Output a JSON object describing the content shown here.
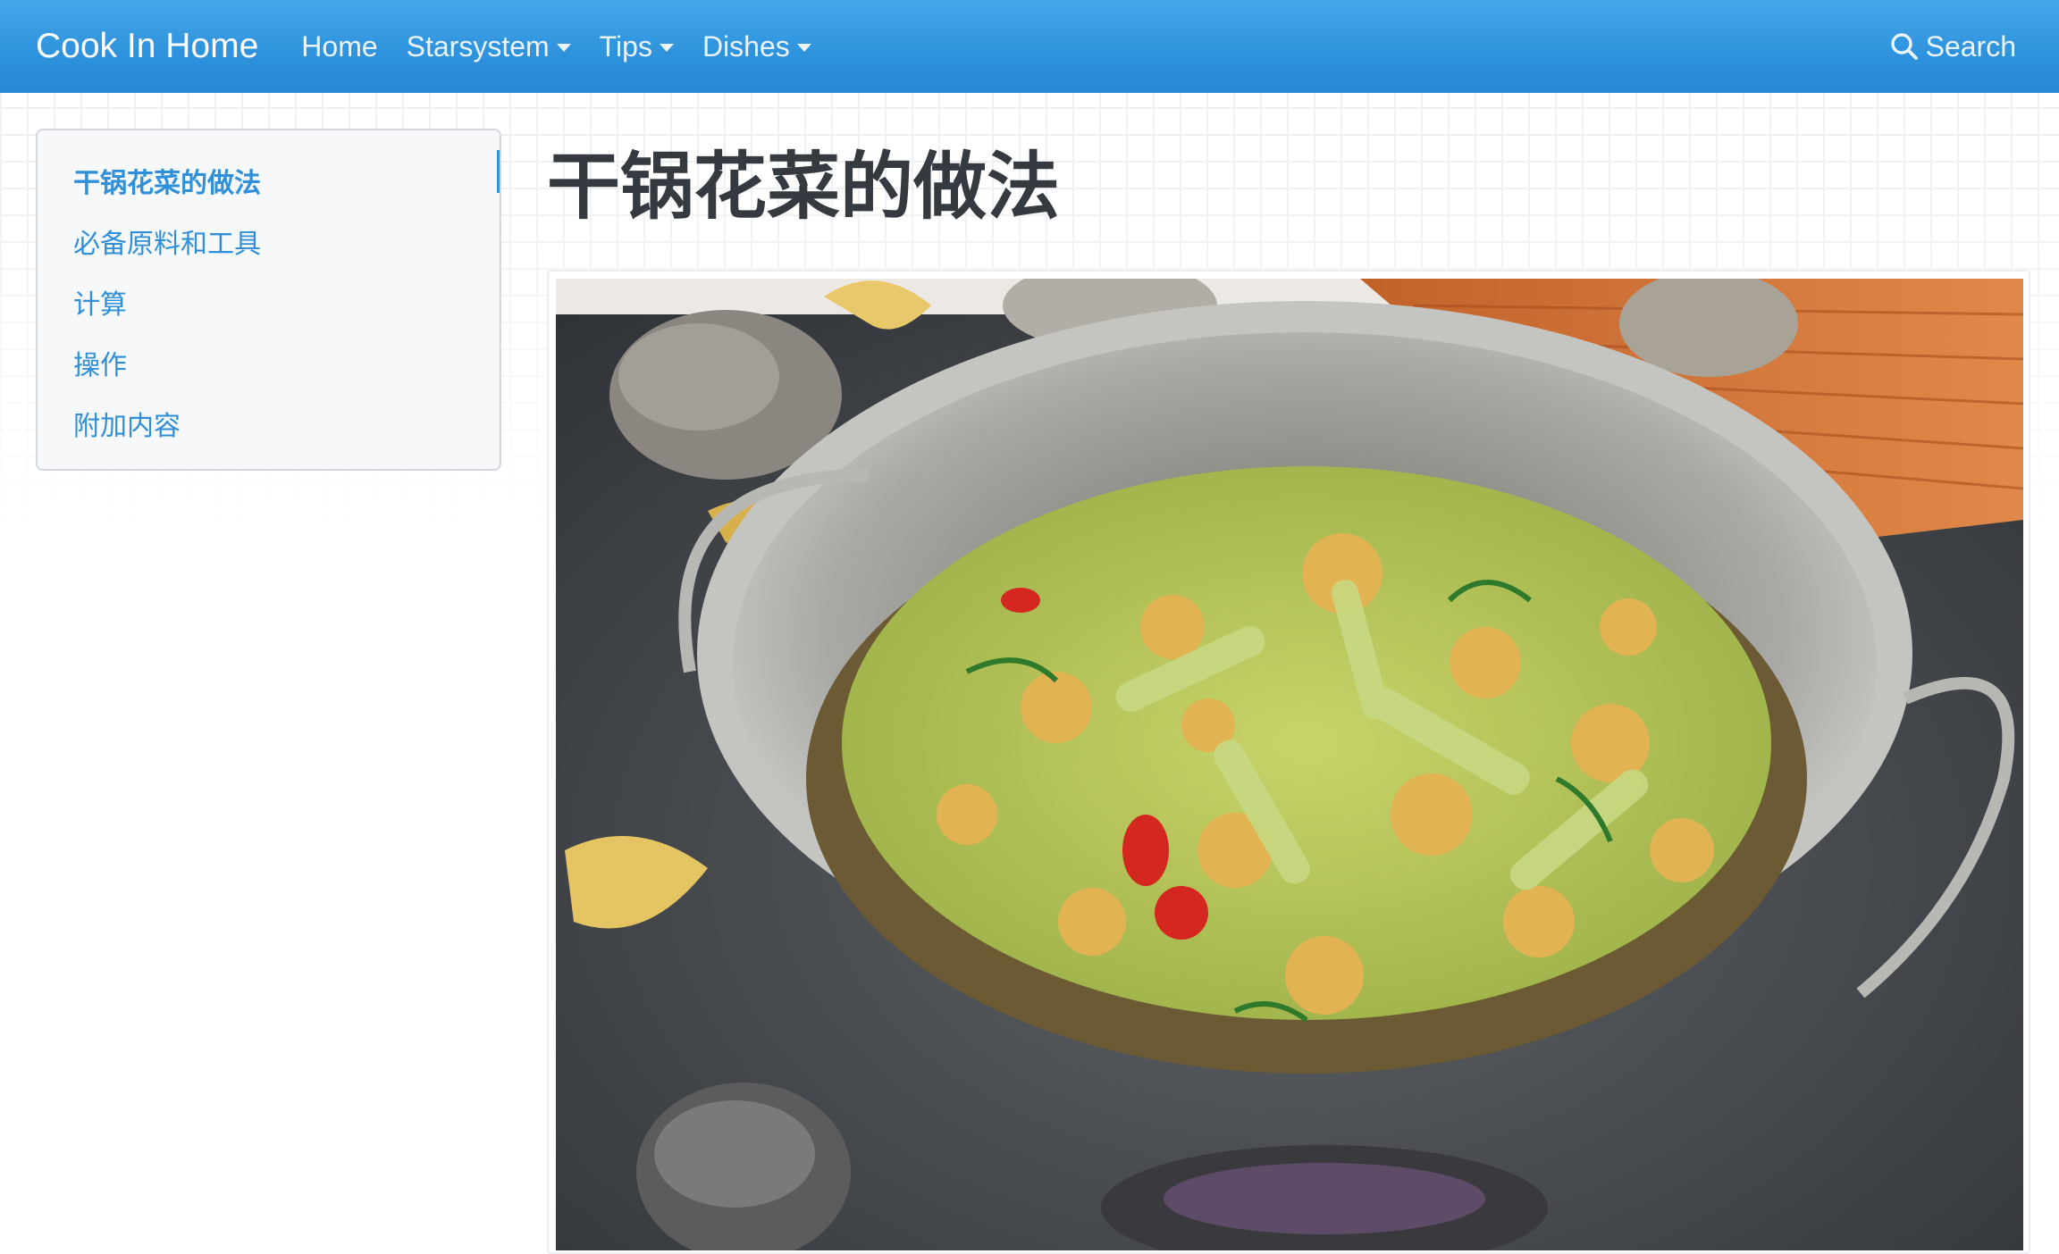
{
  "navbar": {
    "brand": "Cook In Home",
    "links": [
      {
        "label": "Home",
        "dropdown": false
      },
      {
        "label": "Starsystem",
        "dropdown": true
      },
      {
        "label": "Tips",
        "dropdown": true
      },
      {
        "label": "Dishes",
        "dropdown": true
      }
    ],
    "search_label": "Search",
    "search_icon": "search-icon"
  },
  "toc": {
    "items": [
      {
        "label": "干锅花菜的做法",
        "active": true
      },
      {
        "label": "必备原料和工具",
        "active": false
      },
      {
        "label": "计算",
        "active": false
      },
      {
        "label": "操作",
        "active": false
      },
      {
        "label": "附加内容",
        "active": false
      }
    ]
  },
  "main": {
    "title": "干锅花菜的做法"
  },
  "colors": {
    "navbar": "#2f93dd",
    "link": "#2f8fd8",
    "title": "#343a40",
    "toc_background": "#f6f8fa"
  }
}
